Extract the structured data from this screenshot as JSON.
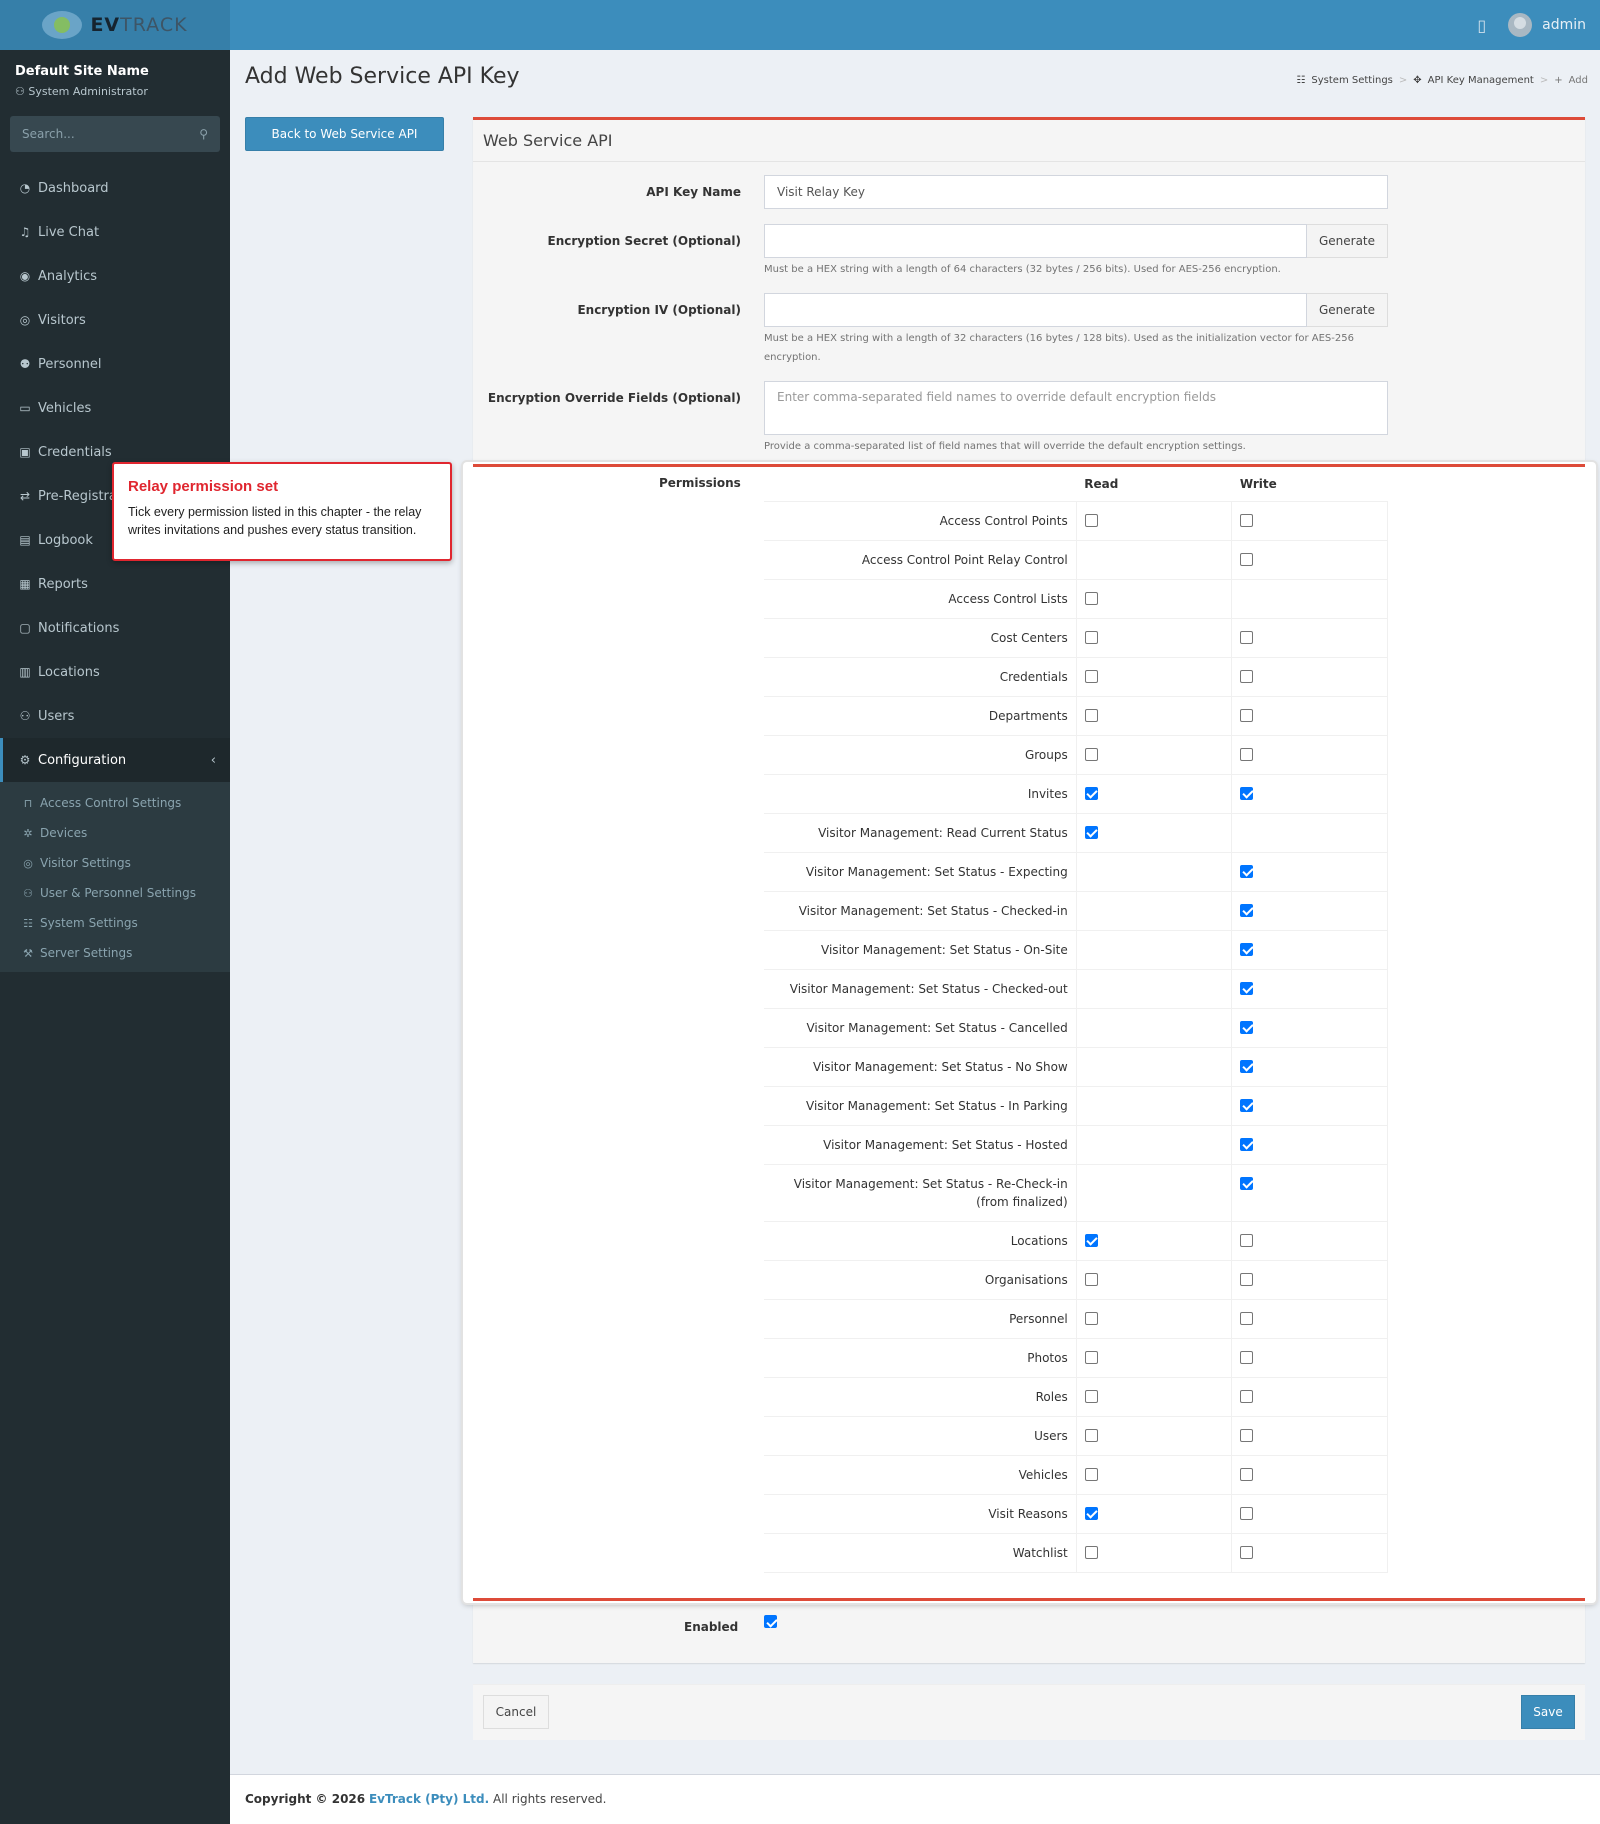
{
  "brand": {
    "logo_bold": "EV",
    "logo_light": "TRACK"
  },
  "topbar": {
    "user": "admin"
  },
  "sidebar": {
    "site_name": "Default Site Name",
    "role": "System Administrator",
    "search_placeholder": "Search...",
    "items": [
      {
        "label": "Dashboard",
        "icon": "dashboard-icon"
      },
      {
        "label": "Live Chat",
        "icon": "headset-icon"
      },
      {
        "label": "Analytics",
        "icon": "analytics-icon"
      },
      {
        "label": "Visitors",
        "icon": "eye-icon"
      },
      {
        "label": "Personnel",
        "icon": "personnel-icon"
      },
      {
        "label": "Vehicles",
        "icon": "vehicle-icon"
      },
      {
        "label": "Credentials",
        "icon": "credentials-icon"
      },
      {
        "label": "Pre-Registration",
        "icon": "pre-registration-icon"
      },
      {
        "label": "Logbook",
        "icon": "logbook-icon"
      },
      {
        "label": "Reports",
        "icon": "reports-icon"
      },
      {
        "label": "Notifications",
        "icon": "notifications-icon"
      },
      {
        "label": "Locations",
        "icon": "locations-icon"
      },
      {
        "label": "Users",
        "icon": "users-icon"
      }
    ],
    "active": {
      "label": "Configuration",
      "icon": "gear-icon"
    },
    "sub_items": [
      {
        "label": "Access Control Settings",
        "icon": "lock-icon"
      },
      {
        "label": "Devices",
        "icon": "devices-icon"
      },
      {
        "label": "Visitor Settings",
        "icon": "eye-icon"
      },
      {
        "label": "User & Personnel Settings",
        "icon": "users-icon"
      },
      {
        "label": "System Settings",
        "icon": "sliders-icon"
      },
      {
        "label": "Server Settings",
        "icon": "server-icon"
      }
    ]
  },
  "page": {
    "title": "Add Web Service API Key",
    "back_button": "Back to Web Service API",
    "breadcrumb": [
      "System Settings",
      "API Key Management",
      "Add"
    ]
  },
  "form": {
    "box_title": "Web Service API",
    "api_key_name_label": "API Key Name",
    "api_key_name_value": "Visit Relay Key",
    "secret_label": "Encryption Secret (Optional)",
    "secret_help": "Must be a HEX string with a length of 64 characters (32 bytes / 256 bits). Used for AES-256 encryption.",
    "iv_label": "Encryption IV (Optional)",
    "iv_help": "Must be a HEX string with a length of 32 characters (16 bytes / 128 bits). Used as the initialization vector for AES-256 encryption.",
    "generate_label": "Generate",
    "override_label": "Encryption Override Fields (Optional)",
    "override_placeholder": "Enter comma-separated field names to override default encryption fields",
    "override_help": "Provide a comma-separated list of field names that will override the default encryption settings.",
    "permissions_label": "Permissions",
    "read_header": "Read",
    "write_header": "Write",
    "enabled_label": "Enabled",
    "cancel_label": "Cancel",
    "save_label": "Save"
  },
  "permissions": [
    {
      "name": "Access Control Points",
      "read": false,
      "write": false
    },
    {
      "name": "Access Control Point Relay Control",
      "read": null,
      "write": false
    },
    {
      "name": "Access Control Lists",
      "read": false,
      "write": null
    },
    {
      "name": "Cost Centers",
      "read": false,
      "write": false
    },
    {
      "name": "Credentials",
      "read": false,
      "write": false
    },
    {
      "name": "Departments",
      "read": false,
      "write": false
    },
    {
      "name": "Groups",
      "read": false,
      "write": false
    },
    {
      "name": "Invites",
      "read": true,
      "write": true
    },
    {
      "name": "Visitor Management: Read Current Status",
      "read": true,
      "write": null
    },
    {
      "name": "Visitor Management: Set Status - Expecting",
      "read": null,
      "write": true
    },
    {
      "name": "Visitor Management: Set Status - Checked-in",
      "read": null,
      "write": true
    },
    {
      "name": "Visitor Management: Set Status - On-Site",
      "read": null,
      "write": true
    },
    {
      "name": "Visitor Management: Set Status - Checked-out",
      "read": null,
      "write": true
    },
    {
      "name": "Visitor Management: Set Status - Cancelled",
      "read": null,
      "write": true
    },
    {
      "name": "Visitor Management: Set Status - No Show",
      "read": null,
      "write": true
    },
    {
      "name": "Visitor Management: Set Status - In Parking",
      "read": null,
      "write": true
    },
    {
      "name": "Visitor Management: Set Status - Hosted",
      "read": null,
      "write": true
    },
    {
      "name": "Visitor Management: Set Status - Re-Check-in (from finalized)",
      "read": null,
      "write": true
    },
    {
      "name": "Locations",
      "read": true,
      "write": false
    },
    {
      "name": "Organisations",
      "read": false,
      "write": false
    },
    {
      "name": "Personnel",
      "read": false,
      "write": false
    },
    {
      "name": "Photos",
      "read": false,
      "write": false
    },
    {
      "name": "Roles",
      "read": false,
      "write": false
    },
    {
      "name": "Users",
      "read": false,
      "write": false
    },
    {
      "name": "Vehicles",
      "read": false,
      "write": false
    },
    {
      "name": "Visit Reasons",
      "read": true,
      "write": false
    },
    {
      "name": "Watchlist",
      "read": false,
      "write": false
    }
  ],
  "callout": {
    "title": "Relay permission set",
    "text": "Tick every permission listed in this chapter - the relay writes invitations and pushes every status transition."
  },
  "footer": {
    "prefix": "Copyright © 2026",
    "company": "EvTrack (Pty) Ltd.",
    "suffix": "All rights reserved."
  }
}
